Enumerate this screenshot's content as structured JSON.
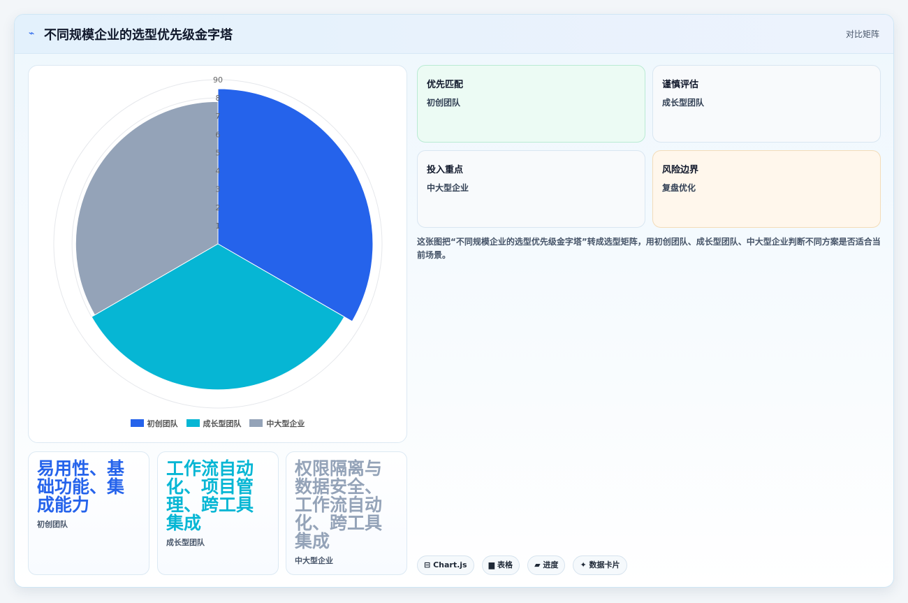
{
  "header": {
    "logo_glyph": "⌁",
    "title": "不同规模企业的选型优先级金字塔",
    "mode": "对比矩阵"
  },
  "chart_data": {
    "type": "polarArea",
    "categories": [
      "初创团队",
      "成长型团队",
      "中大型企业"
    ],
    "values": [
      85,
      80,
      78
    ],
    "colors": [
      "#2563eb",
      "#06b6d4",
      "#94a3b8"
    ],
    "r_ticks": [
      "90",
      "8",
      "7",
      "6",
      "5",
      "4",
      "3",
      "2",
      "1"
    ],
    "r_range": [
      0,
      90
    ],
    "legend_position": "bottom"
  },
  "tiles": [
    {
      "text": "易用性、基础功能、集成能力",
      "label": "初创团队",
      "color": "#2563eb"
    },
    {
      "text": "工作流自动化、项目管理、跨工具集成",
      "label": "成长型团队",
      "color": "#06b6d4"
    },
    {
      "text": "权限隔离与数据安全、工作流自动化、跨工具集成",
      "label": "中大型企业",
      "color": "#94a3b8"
    }
  ],
  "matrix": [
    {
      "title": "优先匹配",
      "value": "初创团队",
      "bg": "#ecfbf4",
      "border": "#b9ebd3"
    },
    {
      "title": "谨慎评估",
      "value": "成长型团队",
      "bg": "#f8fafc",
      "border": "#d9e6f1"
    },
    {
      "title": "投入重点",
      "value": "中大型企业",
      "bg": "#f8fafc",
      "border": "#d9e6f1"
    },
    {
      "title": "风险边界",
      "value": "复盘优化",
      "bg": "#fff7ec",
      "border": "#f3dcb8"
    }
  ],
  "description": "这张图把“不同规模企业的选型优先级金字塔”转成选型矩阵，用初创团队、成长型团队、中大型企业判断不同方案是否适合当前场景。",
  "tags": [
    {
      "icon": "⊟",
      "label": "Chart.js"
    },
    {
      "icon": "▆",
      "label": "表格"
    },
    {
      "icon": "▰",
      "label": "进度"
    },
    {
      "icon": "✦",
      "label": "数据卡片"
    }
  ]
}
